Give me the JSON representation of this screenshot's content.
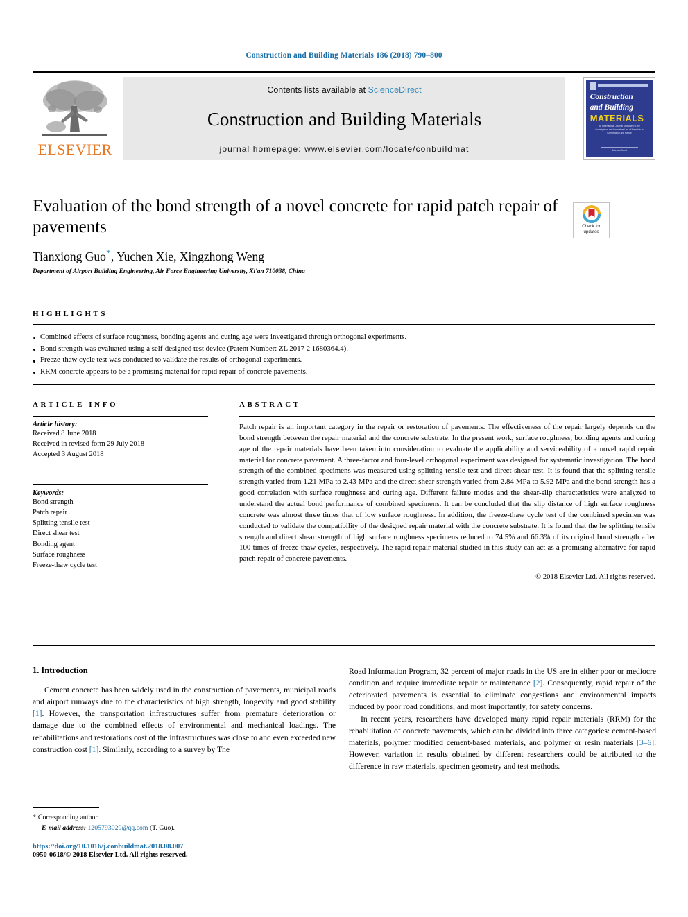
{
  "running_head": "Construction and Building Materials 186 (2018) 790–800",
  "masthead": {
    "publisher_name": "ELSEVIER",
    "contents_prefix": "Contents lists available at ",
    "contents_link": "ScienceDirect",
    "journal_title": "Construction and Building Materials",
    "homepage": "journal homepage: www.elsevier.com/locate/conbuildmat",
    "cover": {
      "line1": "Construction",
      "line2": "and Building",
      "line3": "MATERIALS",
      "blurb": "An International Journal Dedicated to the Investigation and Innovative Use of Materials in Construction and Repair",
      "footer": "ScienceDirect"
    }
  },
  "article": {
    "title": "Evaluation of the bond strength of a novel concrete for rapid patch repair of pavements",
    "authors": "Tianxiong Guo",
    "authors_rest": ", Yuchen Xie, Xingzhong Weng",
    "corresponding_marker": "*",
    "affiliation": "Department of Airport Building Engineering, Air Force Engineering University, Xi'an 710038, China"
  },
  "crossmark": {
    "line1": "Check for",
    "line2": "updates"
  },
  "highlights": {
    "label": "HIGHLIGHTS",
    "items": [
      "Combined effects of surface roughness, bonding agents and curing age were investigated through orthogonal experiments.",
      "Bond strength was evaluated using a self-designed test device (Patent Number: ZL 2017 2 1680364.4).",
      "Freeze-thaw cycle test was conducted to validate the results of orthogonal experiments.",
      "RRM concrete appears to be a promising material for rapid repair of concrete pavements."
    ]
  },
  "article_info": {
    "label": "ARTICLE INFO",
    "history_head": "Article history:",
    "history": [
      "Received 8 June 2018",
      "Received in revised form 29 July 2018",
      "Accepted 3 August 2018"
    ],
    "keywords_head": "Keywords:",
    "keywords": [
      "Bond strength",
      "Patch repair",
      "Splitting tensile test",
      "Direct shear test",
      "Bonding agent",
      "Surface roughness",
      "Freeze-thaw cycle test"
    ]
  },
  "abstract": {
    "label": "ABSTRACT",
    "text": "Patch repair is an important category in the repair or restoration of pavements. The effectiveness of the repair largely depends on the bond strength between the repair material and the concrete substrate. In the present work, surface roughness, bonding agents and curing age of the repair materials have been taken into consideration to evaluate the applicability and serviceability of a novel rapid repair material for concrete pavement. A three-factor and four-level orthogonal experiment was designed for systematic investigation. The bond strength of the combined specimens was measured using splitting tensile test and direct shear test. It is found that the splitting tensile strength varied from 1.21 MPa to 2.43 MPa and the direct shear strength varied from 2.84 MPa to 5.92 MPa and the bond strength has a good correlation with surface roughness and curing age. Different failure modes and the shear-slip characteristics were analyzed to understand the actual bond performance of combined specimens. It can be concluded that the slip distance of high surface roughness concrete was almost three times that of low surface roughness. In addition, the freeze-thaw cycle test of the combined specimen was conducted to validate the compatibility of the designed repair material with the concrete substrate. It is found that the he splitting tensile strength and direct shear strength of high surface roughness specimens reduced to 74.5% and 66.3% of its original bond strength after 100 times of freeze-thaw cycles, respectively. The rapid repair material studied in this study can act as a promising alternative for rapid patch repair of concrete pavements.",
    "copyright": "© 2018 Elsevier Ltd. All rights reserved."
  },
  "introduction": {
    "heading": "1. Introduction",
    "left_para_1a": "Cement concrete has been widely used in the construction of pavements, municipal roads and airport runways due to the characteristics of high strength, longevity and good stability ",
    "left_ref_1": "[1]",
    "left_para_1b": ". However, the transportation infrastructures suffer from premature deterioration or damage due to the combined effects of environmental and mechanical loadings. The rehabilitations and restorations cost of the infrastructures was close to and even exceeded new construction cost ",
    "left_ref_2": "[1]",
    "left_para_1c": ". Similarly, according to a survey by The",
    "right_para_1a": "Road Information Program, 32 percent of major roads in the US are in either poor or mediocre condition and require immediate repair or maintenance ",
    "right_ref_1": "[2]",
    "right_para_1b": ". Consequently, rapid repair of the deteriorated pavements is essential to eliminate congestions and environmental impacts induced by poor road conditions, and most importantly, for safety concerns.",
    "right_para_2a": "In recent years, researchers have developed many rapid repair materials (RRM) for the rehabilitation of concrete pavements, which can be divided into three categories: cement-based materials, polymer modified cement-based materials, and polymer or resin materials ",
    "right_ref_2": "[3–6]",
    "right_para_2b": ". However, variation in results obtained by different researchers could be attributed to the difference in raw materials, specimen geometry and test methods."
  },
  "footnote": {
    "star": "*",
    "corresponding": "Corresponding author.",
    "email_label": "E-mail address:",
    "email": "1205793029@qq.com",
    "email_suffix": "(T. Guo)."
  },
  "footer": {
    "doi": "https://doi.org/10.1016/j.conbuildmat.2018.08.007",
    "issn": "0950-0618/© 2018 Elsevier Ltd. All rights reserved."
  },
  "colors": {
    "link_blue": "#1a6ea8",
    "sciencedirect_blue": "#3c8dbc",
    "elsevier_orange": "#e87722",
    "cover_blue": "#2e3c8f",
    "cover_yellow": "#f2d021"
  }
}
